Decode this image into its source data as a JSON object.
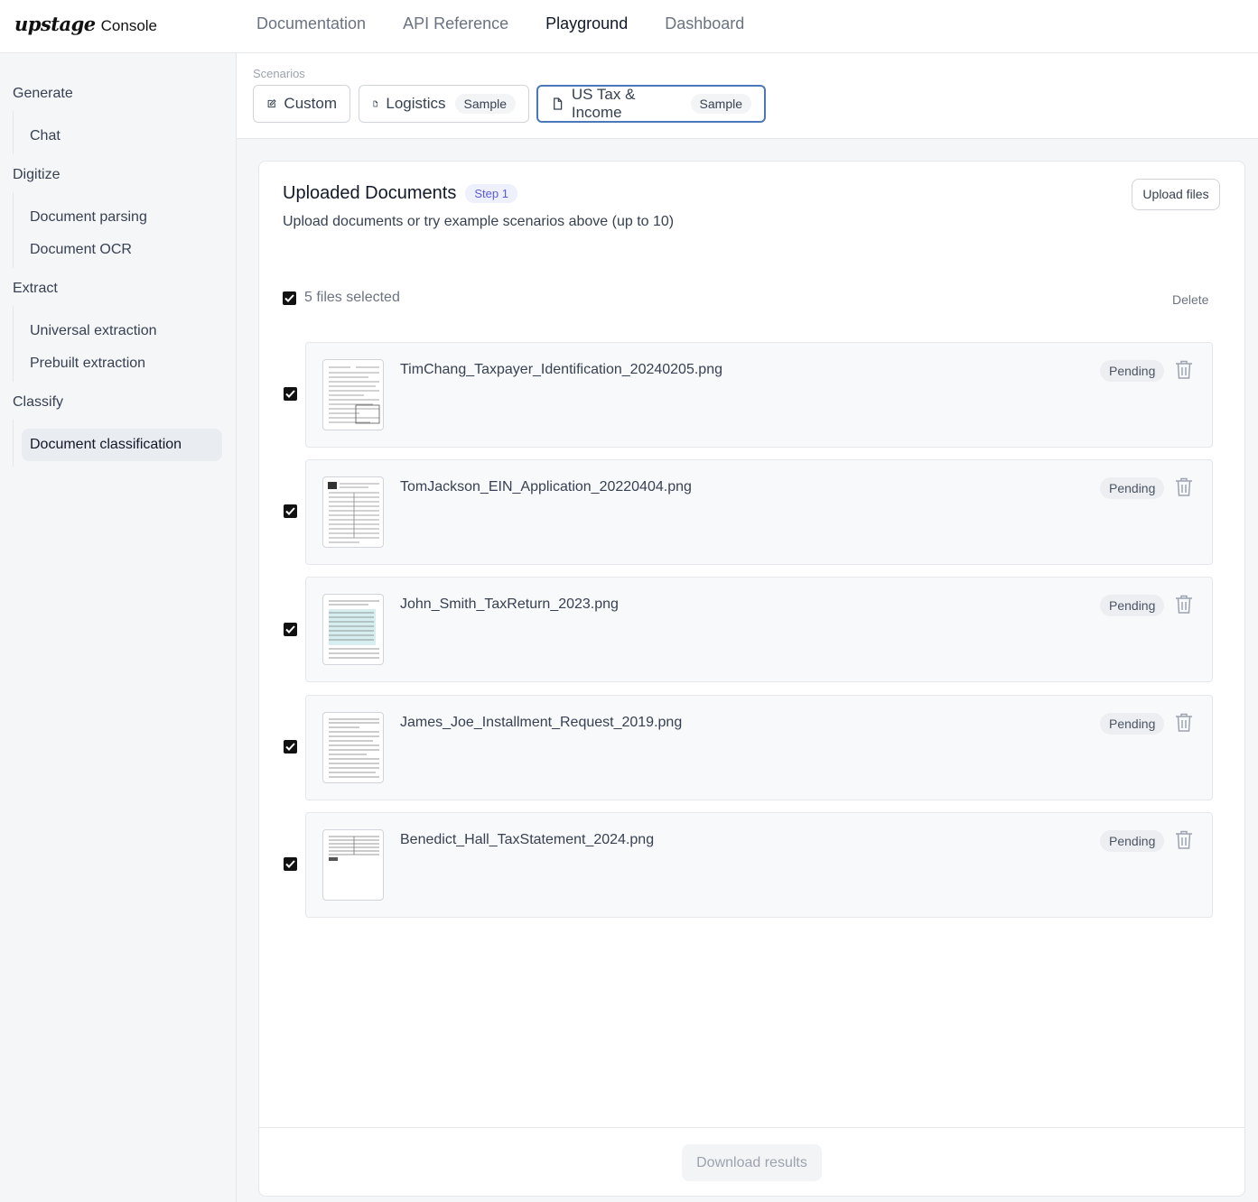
{
  "header": {
    "logo_mark": "upstage",
    "logo_text": "Console",
    "nav": [
      "Documentation",
      "API Reference",
      "Playground",
      "Dashboard"
    ],
    "active_nav": "Playground"
  },
  "sidebar": {
    "groups": [
      {
        "label": "Generate",
        "items": [
          "Chat"
        ]
      },
      {
        "label": "Digitize",
        "items": [
          "Document parsing",
          "Document OCR"
        ]
      },
      {
        "label": "Extract",
        "items": [
          "Universal extraction",
          "Prebuilt extraction"
        ]
      },
      {
        "label": "Classify",
        "items": [
          "Document classification"
        ]
      }
    ],
    "active_item": "Document classification"
  },
  "scenarios": {
    "label": "Scenarios",
    "buttons": [
      {
        "label": "Custom",
        "badge": "",
        "icon": "edit-icon"
      },
      {
        "label": "Logistics",
        "badge": "Sample",
        "icon": "file-icon"
      },
      {
        "label": "US Tax & Income",
        "badge": "Sample",
        "icon": "file-icon"
      }
    ],
    "active": "US Tax & Income"
  },
  "documents": {
    "title": "Uploaded Documents",
    "step": "Step 1",
    "subtitle": "Upload documents or try example scenarios above (up to 10)",
    "upload_label": "Upload files",
    "selected_text": "5 files selected",
    "delete_label": "Delete",
    "files": [
      {
        "name": "TimChang_Taxpayer_Identification_20240205.png",
        "status": "Pending",
        "checked": true
      },
      {
        "name": "TomJackson_EIN_Application_20220404.png",
        "status": "Pending",
        "checked": true
      },
      {
        "name": "John_Smith_TaxReturn_2023.png",
        "status": "Pending",
        "checked": true
      },
      {
        "name": "James_Joe_Installment_Request_2019.png",
        "status": "Pending",
        "checked": true
      },
      {
        "name": "Benedict_Hall_TaxStatement_2024.png",
        "status": "Pending",
        "checked": true
      }
    ],
    "download_label": "Download results"
  }
}
